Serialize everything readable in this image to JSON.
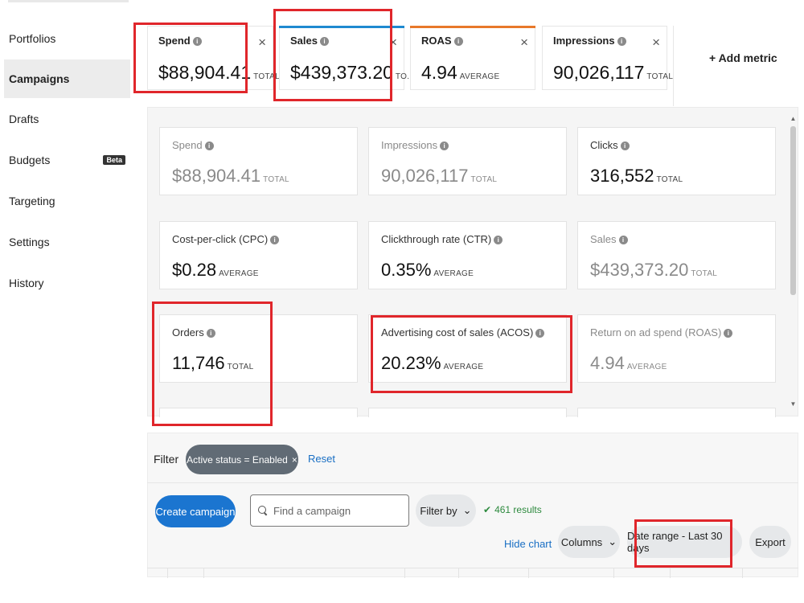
{
  "sidebar": {
    "items": [
      {
        "label": "Portfolios"
      },
      {
        "label": "Campaigns",
        "active": true
      },
      {
        "label": "Drafts"
      },
      {
        "label": "Budgets",
        "badge": "Beta"
      },
      {
        "label": "Targeting"
      },
      {
        "label": "Settings"
      },
      {
        "label": "History"
      }
    ]
  },
  "metric_tabs": [
    {
      "label": "Spend",
      "value": "$88,904.41",
      "suffix": "TOTAL",
      "close": "×",
      "accent": ""
    },
    {
      "label": "Sales",
      "value": "$439,373.20",
      "suffix": "TO...",
      "close": "×",
      "accent": "#1f8ad0"
    },
    {
      "label": "ROAS",
      "value": "4.94",
      "suffix": "AVERAGE",
      "close": "×",
      "accent": "#e8782a"
    },
    {
      "label": "Impressions",
      "value": "90,026,117",
      "suffix": "TOTAL",
      "close": "×",
      "accent": ""
    }
  ],
  "add_metric": {
    "icon": "+",
    "label": "Add metric"
  },
  "metric_cards": [
    {
      "label": "Spend",
      "value": "$88,904.41",
      "suffix": "TOTAL",
      "state": "dim"
    },
    {
      "label": "Impressions",
      "value": "90,026,117",
      "suffix": "TOTAL",
      "state": "dim"
    },
    {
      "label": "Clicks",
      "value": "316,552",
      "suffix": "TOTAL",
      "state": "on"
    },
    {
      "label": "Cost-per-click (CPC)",
      "value": "$0.28",
      "suffix": "AVERAGE",
      "state": "on"
    },
    {
      "label": "Clickthrough rate (CTR)",
      "value": "0.35%",
      "suffix": "AVERAGE",
      "state": "on"
    },
    {
      "label": "Sales",
      "value": "$439,373.20",
      "suffix": "TOTAL",
      "state": "dim"
    },
    {
      "label": "Orders",
      "value": "11,746",
      "suffix": "TOTAL",
      "state": "on"
    },
    {
      "label": "Advertising cost of sales (ACOS)",
      "value": "20.23%",
      "suffix": "AVERAGE",
      "state": "on"
    },
    {
      "label": "Return on ad spend (ROAS)",
      "value": "4.94",
      "suffix": "AVERAGE",
      "state": "dim"
    }
  ],
  "filter": {
    "label": "Filter",
    "chip": "Active status = Enabled",
    "chip_close": "×",
    "reset": "Reset"
  },
  "toolbar": {
    "create_campaign": "Create campaign",
    "search_placeholder": "Find a campaign",
    "filter_by": "Filter by",
    "results": "461 results",
    "hide_chart": "Hide chart",
    "columns": "Columns",
    "date_range": "Date range - Last 30 days",
    "export": "Export"
  },
  "colors": {
    "highlight": "#e0262b",
    "primary": "#1b75d0",
    "sales_accent": "#1f8ad0",
    "roas_accent": "#e8782a",
    "success": "#2d8a3e"
  }
}
